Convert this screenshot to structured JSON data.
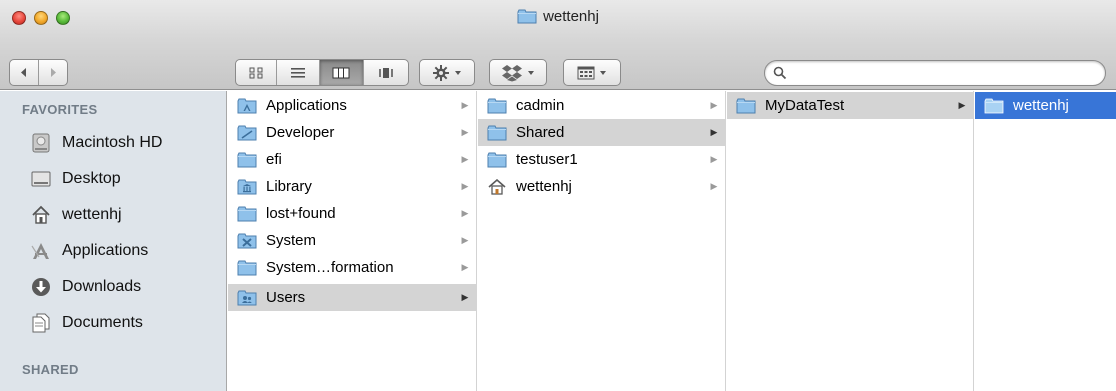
{
  "window": {
    "title": "wettenhj"
  },
  "toolbar": {
    "search": {
      "value": "",
      "placeholder": ""
    }
  },
  "sidebar": {
    "favorites_header": "FAVORITES",
    "shared_header": "SHARED",
    "items": [
      {
        "label": "Macintosh HD",
        "icon": "hard-disk-icon"
      },
      {
        "label": "Desktop",
        "icon": "desktop-icon"
      },
      {
        "label": "wettenhj",
        "icon": "home-icon"
      },
      {
        "label": "Applications",
        "icon": "applications-icon"
      },
      {
        "label": "Downloads",
        "icon": "downloads-icon"
      },
      {
        "label": "Documents",
        "icon": "documents-icon"
      }
    ]
  },
  "columns": [
    {
      "items": [
        {
          "label": "Applications",
          "icon": "applications-folder-icon",
          "selected": false
        },
        {
          "label": "Developer",
          "icon": "developer-folder-icon",
          "selected": false
        },
        {
          "label": "efi",
          "icon": "folder-icon",
          "selected": false
        },
        {
          "label": "Library",
          "icon": "library-folder-icon",
          "selected": false
        },
        {
          "label": "lost+found",
          "icon": "folder-icon",
          "selected": false
        },
        {
          "label": "System",
          "icon": "system-folder-icon",
          "selected": false
        },
        {
          "label": "System…formation",
          "icon": "folder-icon",
          "selected": false
        },
        {
          "label": "Users",
          "icon": "users-folder-icon",
          "selected": true
        }
      ]
    },
    {
      "items": [
        {
          "label": "cadmin",
          "icon": "folder-icon",
          "selected": false
        },
        {
          "label": "Shared",
          "icon": "folder-icon",
          "selected": true
        },
        {
          "label": "testuser1",
          "icon": "folder-icon",
          "selected": false
        },
        {
          "label": "wettenhj",
          "icon": "home-icon",
          "selected": false
        }
      ]
    },
    {
      "items": [
        {
          "label": "MyDataTest",
          "icon": "folder-icon",
          "selected": true
        }
      ]
    },
    {
      "items": [
        {
          "label": "wettenhj",
          "icon": "folder-icon",
          "selected": true,
          "focused": true
        }
      ]
    }
  ],
  "colors": {
    "selection_blue": "#3875d7",
    "selection_gray": "#d4d4d4",
    "sidebar_bg": "#dee4ea",
    "folder_blue": "#8fc1ea"
  }
}
